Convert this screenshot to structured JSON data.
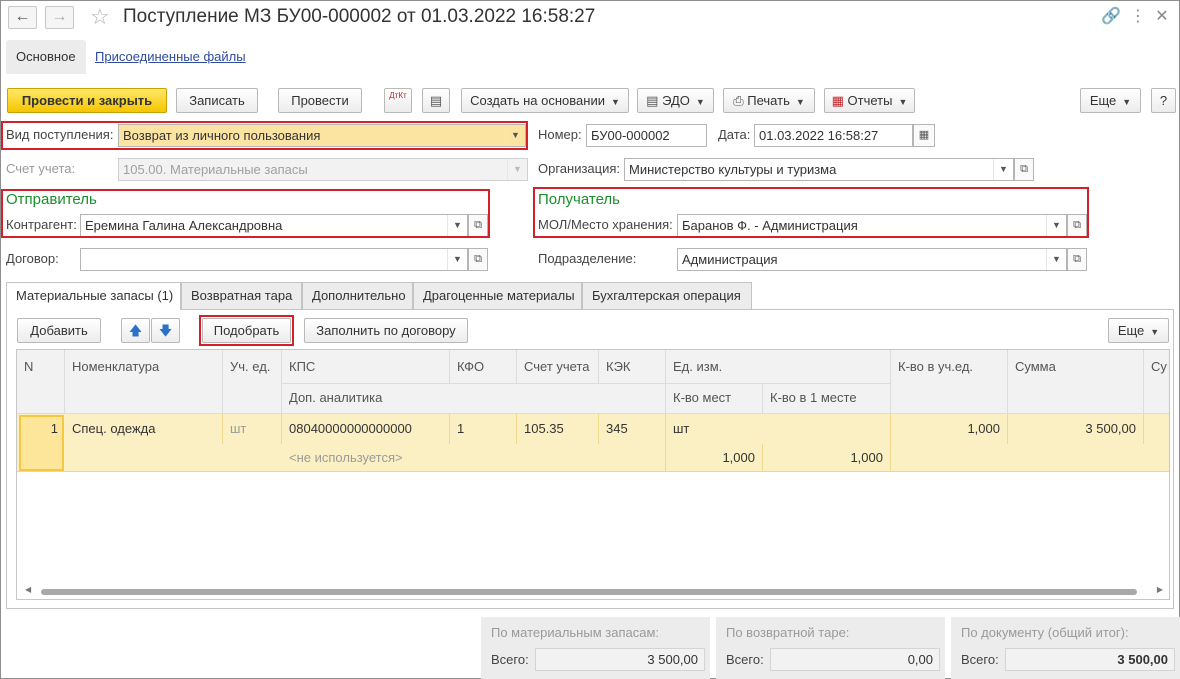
{
  "window": {
    "title": "Поступление МЗ БУ00-000002 от 01.03.2022 16:58:27",
    "tabs": [
      "Основное",
      "Присоединенные файлы"
    ]
  },
  "toolbar": {
    "post_close": "Провести и закрыть",
    "save": "Записать",
    "post": "Провести",
    "dtkt": "ДтКт",
    "create_based": "Создать на основании",
    "edo": "ЭДО",
    "print": "Печать",
    "reports": "Отчеты",
    "more": "Еще",
    "help": "?"
  },
  "form": {
    "receipt_type_label": "Вид поступления:",
    "receipt_type_value": "Возврат из личного пользования",
    "number_label": "Номер:",
    "number_value": "БУ00-000002",
    "date_label": "Дата:",
    "date_value": "01.03.2022 16:58:27",
    "account_label": "Счет учета:",
    "account_value": "105.00. Материальные запасы",
    "org_label": "Организация:",
    "org_value": "Министерство культуры и туризма",
    "sender_title": "Отправитель",
    "counterparty_label": "Контрагент:",
    "counterparty_value": "Еремина Галина Александровна",
    "receiver_title": "Получатель",
    "mol_label": "МОЛ/Место хранения:",
    "mol_value": "Баранов Ф. - Администрация",
    "contract_label": "Договор:",
    "contract_value": "",
    "division_label": "Подразделение:",
    "division_value": "Администрация"
  },
  "lower_tabs": [
    "Материальные запасы (1)",
    "Возвратная тара",
    "Дополнительно",
    "Драгоценные материалы",
    "Бухгалтерская операция"
  ],
  "grid_toolbar": {
    "add": "Добавить",
    "pick": "Подобрать",
    "fill_contract": "Заполнить по договору",
    "more": "Еще"
  },
  "table": {
    "headers": {
      "n": "N",
      "nomenclature": "Номенклатура",
      "unit": "Уч. ед.",
      "kps": "КПС",
      "kfo": "КФО",
      "account": "Счет учета",
      "kek": "КЭК",
      "measure": "Ед. изм.",
      "qty_unit": "К-во в уч.ед.",
      "sum": "Сумма",
      "su": "Су",
      "extra": "Доп. аналитика",
      "places": "К-во мест",
      "per_place": "К-во в 1 месте"
    },
    "rows": [
      {
        "n": "1",
        "nomenclature": "Спец. одежда",
        "unit": "шт",
        "kps": "08040000000000000",
        "kfo": "1",
        "account": "105.35",
        "kek": "345",
        "measure": "шт",
        "qty_unit": "1,000",
        "sum": "3 500,00",
        "extra": "<не используется>",
        "places": "1,000",
        "per_place": "1,000"
      }
    ]
  },
  "totals": {
    "materials_caption": "По материальным запасам:",
    "materials_total_label": "Всего:",
    "materials_total": "3 500,00",
    "tara_caption": "По возвратной таре:",
    "tara_total_label": "Всего:",
    "tara_total": "0,00",
    "doc_caption": "По документу (общий итог):",
    "doc_total_label": "Всего:",
    "doc_total": "3 500,00"
  }
}
